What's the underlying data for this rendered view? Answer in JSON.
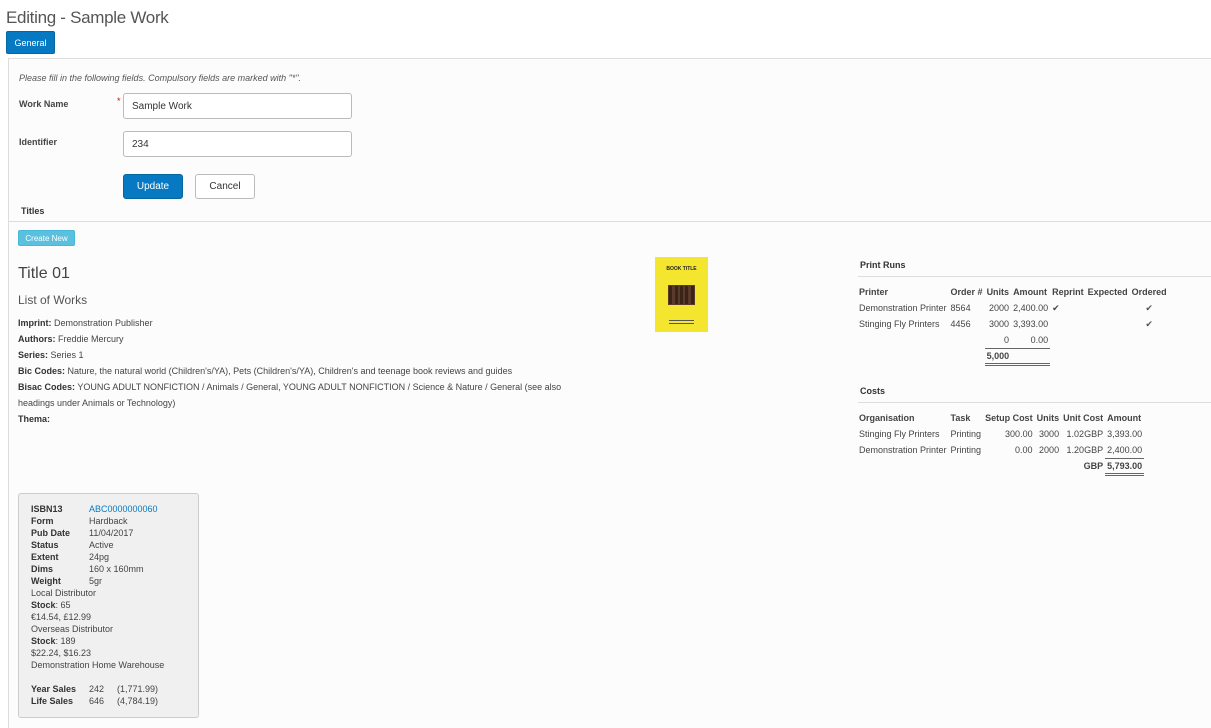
{
  "page": {
    "title": "Editing - Sample Work",
    "tab_general": "General"
  },
  "form": {
    "hint": "Please fill in the following fields. Compulsory fields are marked with \"*\".",
    "work_name_label": "Work Name",
    "work_name_value": "Sample Work",
    "required_mark": "*",
    "identifier_label": "Identifier",
    "identifier_value": "234",
    "update_label": "Update",
    "cancel_label": "Cancel"
  },
  "titles": {
    "heading": "Titles",
    "create_new": "Create New",
    "title_name": "Title 01",
    "subtitle": "List of Works",
    "imprint_label": "Imprint:",
    "imprint_value": "Demonstration Publisher",
    "authors_label": "Authors:",
    "authors_value": "Freddie Mercury",
    "series_label": "Series:",
    "series_value": "Series 1",
    "bic_label": "Bic Codes:",
    "bic_value": "Nature, the natural world (Children's/YA), Pets (Children's/YA), Children's and teenage book reviews and guides",
    "bisac_label": "Bisac Codes:",
    "bisac_value_1": "YOUNG ADULT NONFICTION / Animals / General, YOUNG ADULT NONFICTION / Science & Nature / General (see also",
    "bisac_value_2": "headings under Animals or Technology)",
    "thema_label": "Thema:",
    "cover_text": "BOOK TITLE"
  },
  "print_runs": {
    "heading": "Print Runs",
    "headers": [
      "Printer",
      "Order #",
      "Units",
      "Amount",
      "Reprint",
      "Expected",
      "Ordered"
    ],
    "rows": [
      {
        "printer": "Demonstration Printer",
        "order": "8564",
        "units": "2000",
        "amount": "2,400.00",
        "reprint": "✔",
        "expected": "",
        "ordered": "✔"
      },
      {
        "printer": "Stinging Fly Printers",
        "order": "4456",
        "units": "3000",
        "amount": "3,393.00",
        "reprint": "",
        "expected": "",
        "ordered": "✔"
      },
      {
        "printer": "",
        "order": "",
        "units": "0",
        "amount": "0.00",
        "reprint": "",
        "expected": "",
        "ordered": ""
      }
    ],
    "total_units": "5,000"
  },
  "costs": {
    "heading": "Costs",
    "headers": [
      "Organisation",
      "Task",
      "Setup Cost",
      "Units",
      "Unit Cost",
      "Amount"
    ],
    "rows": [
      {
        "org": "Stinging Fly Printers",
        "task": "Printing",
        "setup": "300.00",
        "units": "3000",
        "unit_cost": "1.02GBP",
        "amount": "3,393.00"
      },
      {
        "org": "Demonstration Printer",
        "task": "Printing",
        "setup": "0.00",
        "units": "2000",
        "unit_cost": "1.20GBP",
        "amount": "2,400.00"
      }
    ],
    "total_label": "GBP",
    "total_amount": "5,793.00"
  },
  "isbn": {
    "isbn_label": "ISBN13",
    "isbn_value": "ABC0000000060",
    "form_label": "Form",
    "form_value": "Hardback",
    "pub_label": "Pub Date",
    "pub_value": "11/04/2017",
    "status_label": "Status",
    "status_value": "Active",
    "extent_label": "Extent",
    "extent_value": "24pg",
    "dims_label": "Dims",
    "dims_value": "160 x 160mm",
    "weight_label": "Weight",
    "weight_value": "5gr",
    "dist1": "Local Distributor",
    "stock_label": "Stock",
    "stock1": ": 65",
    "price1": "€14.54, £12.99",
    "dist2": "Overseas Distributor",
    "stock2": ": 189",
    "price2": "$22.24, $16.23",
    "warehouse": "Demonstration Home Warehouse",
    "year_label": "Year Sales",
    "year_units": "242",
    "year_amount": "(1,771.99)",
    "life_label": "Life Sales",
    "life_units": "646",
    "life_amount": "(4,784.19)"
  }
}
